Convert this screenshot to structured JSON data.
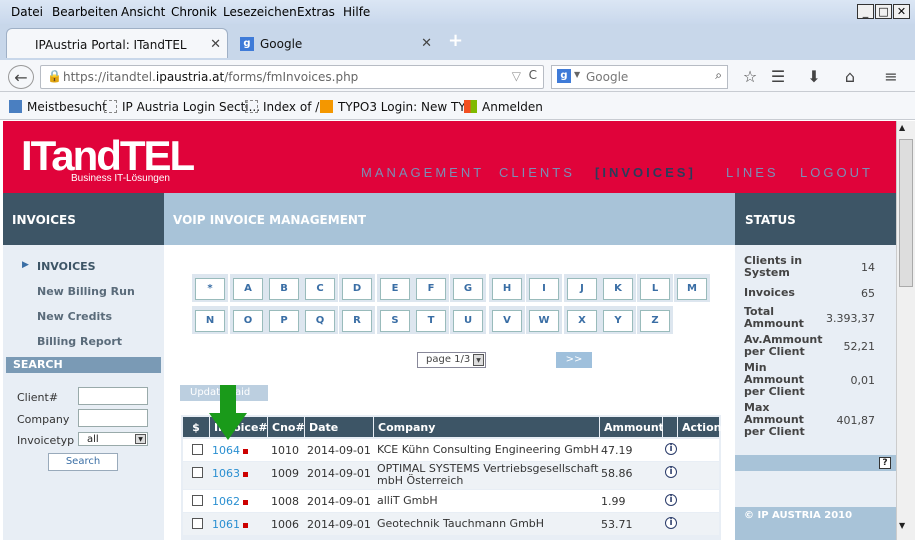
{
  "menubar": [
    "Datei",
    "Bearbeiten",
    "Ansicht",
    "Chronik",
    "Lesezeichen",
    "Extras",
    "Hilfe"
  ],
  "tabs": [
    {
      "label": "IPAustria Portal: ITandTEL"
    },
    {
      "label": "Google"
    }
  ],
  "url": {
    "prefix": "https://itandtel.",
    "host": "ipaustria.at",
    "path": "/forms/fmInvoices.php"
  },
  "search_placeholder": "Google",
  "bookmarks": [
    "Meistbesucht",
    "IP Austria Login Secti...",
    "Index of /",
    "TYPO3 Login: New TY...",
    "Anmelden"
  ],
  "logo": {
    "bold1": "ITand",
    "thin": "",
    "bold2": "TEL",
    "sub": "Business IT-Lösungen"
  },
  "topnav": [
    "MANAGEMENT",
    "CLIENTS",
    "[INVOICES]",
    "LINES",
    "LOGOUT"
  ],
  "left": {
    "header": "INVOICES",
    "menu": [
      "INVOICES",
      "New Billing Run",
      "New Credits",
      "Billing Report"
    ],
    "search_header": "SEARCH",
    "client_label": "Client#",
    "company_label": "Company",
    "invoicetyp_label": "Invoicetyp",
    "invoicetyp_value": "all",
    "search_button": "Search"
  },
  "mid": {
    "header": "VOIP INVOICE MANAGEMENT",
    "pager": "page 1/3",
    "next": ">>",
    "update": "Update Paid"
  },
  "letters_row1": [
    "*",
    "A",
    "B",
    "C",
    "D",
    "E",
    "F",
    "G",
    "H",
    "I",
    "J",
    "K",
    "L",
    "M"
  ],
  "letters_row2": [
    "N",
    "O",
    "P",
    "Q",
    "R",
    "S",
    "T",
    "U",
    "V",
    "W",
    "X",
    "Y",
    "Z"
  ],
  "table": {
    "headers": [
      "$",
      "Invoice#",
      "Cno#",
      "Date",
      "Company",
      "Ammount",
      "",
      "Action"
    ],
    "rows": [
      {
        "inv": "1064",
        "cno": "1010",
        "date": "2014-09-01",
        "company": "KCE Kühn Consulting Engineering GmbH",
        "company2": "",
        "amount": "47.19"
      },
      {
        "inv": "1063",
        "cno": "1009",
        "date": "2014-09-01",
        "company": "OPTIMAL SYSTEMS Vertriebsgesellschaft",
        "company2": "mbH Österreich",
        "amount": "58.86"
      },
      {
        "inv": "1062",
        "cno": "1008",
        "date": "2014-09-01",
        "company": "alliT GmbH",
        "company2": "",
        "amount": "1.99"
      },
      {
        "inv": "1061",
        "cno": "1006",
        "date": "2014-09-01",
        "company": "Geotechnik Tauchmann GmbH",
        "company2": "",
        "amount": "53.71"
      }
    ]
  },
  "status": {
    "header": "STATUS",
    "items": [
      {
        "label": "Clients in System",
        "value": "14"
      },
      {
        "label": "Invoices",
        "value": "65"
      },
      {
        "label": "Total Ammount",
        "value": "3.393,37"
      },
      {
        "label": "Av.Ammount per Client",
        "value": "52,21"
      },
      {
        "label": "Min Ammount per Client",
        "value": "0,01"
      },
      {
        "label": "Max Ammount per Client",
        "value": "401,87"
      }
    ],
    "footer": "© IP AUSTRIA 2010"
  },
  "colors": {
    "brand": "#e0033a",
    "dark": "#3d5566",
    "light": "#a8c3d8",
    "arrow": "#1a9a1a"
  }
}
